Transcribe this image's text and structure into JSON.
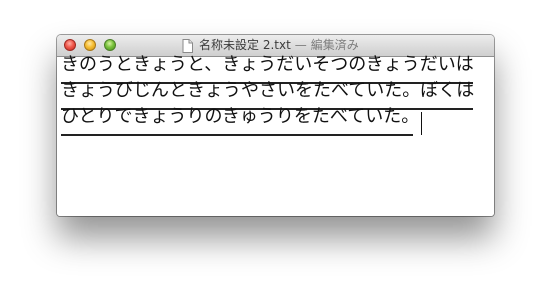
{
  "window": {
    "title": "名称未設定 2.txt",
    "title_separator": "—",
    "status": "編集済み",
    "controls": {
      "close": "close-button",
      "minimize": "minimize-button",
      "zoom": "zoom-button"
    },
    "document_icon": "document-icon"
  },
  "editor": {
    "lines": [
      "きのうときょうと、きょうだいそつのきょうだいは",
      "きょうびじんときょうやさいをたべていた。ぼくは",
      "ひとりできょうりのきゅうりをたべていた。"
    ]
  },
  "colors": {
    "close": "#f0594d",
    "minimize": "#f6be33",
    "zoom": "#79c23c",
    "text": "#111111"
  }
}
